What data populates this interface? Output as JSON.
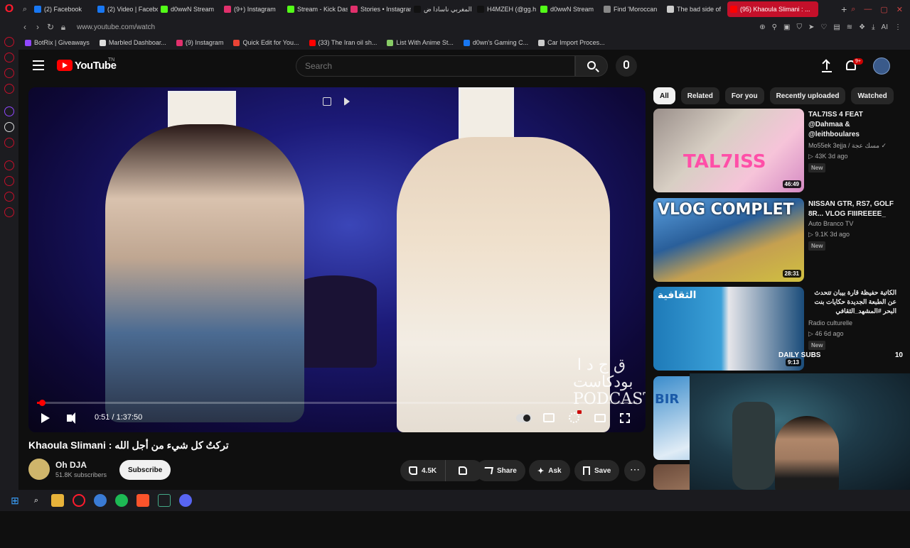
{
  "browser": {
    "tabs": [
      {
        "label": "(2) Facebook",
        "color": "#1877f2"
      },
      {
        "label": "(2) Video | Facebook",
        "color": "#1877f2"
      },
      {
        "label": "d0wwN Stream",
        "color": "#53fc18"
      },
      {
        "label": "(9+) Instagram",
        "color": "#e1306c"
      },
      {
        "label": "Stream - Kick Dash",
        "color": "#53fc18"
      },
      {
        "label": "Stories • Instagram",
        "color": "#e1306c"
      },
      {
        "label": "المغربي ناسادا ض",
        "color": "#111111"
      },
      {
        "label": "H4MZEH (@gg.h",
        "color": "#111111"
      },
      {
        "label": "d0wwN Stream",
        "color": "#53fc18"
      },
      {
        "label": "Find 'Moroccan",
        "color": "#888888"
      },
      {
        "label": "The bad side of",
        "color": "#cccccc"
      },
      {
        "label": "(95) Khaoula Slimani : ...",
        "color": "#ff0000",
        "active": true
      }
    ],
    "url": "www.youtube.com/watch",
    "bookmarks": [
      {
        "label": "BotRix | Giveaways",
        "color": "#9147ff"
      },
      {
        "label": "Marbled Dashboar...",
        "color": "#dddddd"
      },
      {
        "label": "(9) Instagram",
        "color": "#e1306c"
      },
      {
        "label": "Quick Edit for You...",
        "color": "#ea4335"
      },
      {
        "label": "(33) The Iran oil sh...",
        "color": "#ff0000"
      },
      {
        "label": "List With Anime St...",
        "color": "#88cc66"
      },
      {
        "label": "d0wn's Gaming C...",
        "color": "#1877f2"
      },
      {
        "label": "Car Import Proces...",
        "color": "#cccccc"
      }
    ]
  },
  "youtube": {
    "logo_text": "YouTube",
    "region": "TN",
    "search_placeholder": "Search",
    "notifications": "9+",
    "player": {
      "time": "0:51 / 1:37:50",
      "progress": 0.0087,
      "watermark": "ق ج د ا بودكاست PODCAST"
    },
    "video": {
      "title": "Khaoula Slimani : تركتُ كل شيء من أجل الله",
      "channel": "Oh DJA",
      "subscribers": "51.8K subscribers",
      "subscribe_label": "Subscribe",
      "likes": "4.5K",
      "share_label": "Share",
      "ask_label": "Ask",
      "save_label": "Save"
    },
    "chips": [
      "All",
      "Related",
      "For you",
      "Recently uploaded",
      "Watched"
    ],
    "recommendations": [
      {
        "title": "TAL7ISS 4 FEAT @Dahmaa & @leithboulares",
        "channel": "Mo55ek 3ejja / مسك عجة ✓",
        "meta": "▷ 43K  3d ago",
        "badge": "New",
        "duration": "46:49",
        "thumb_text": "TAL7ISS"
      },
      {
        "title": "NISSAN GTR, RS7, GOLF 8R... VLOG FIIIREEEE_",
        "channel": "Auto Branco TV",
        "meta": "▷ 9.1K  3d ago",
        "badge": "New",
        "duration": "28:31",
        "thumb_text": "VLOG COMPLET"
      },
      {
        "title": "الكاتبة حفيظة قارة بيبان تتحدث عن الطبعة الجديدة حكايات بنت البحر #المشهد_الثقافي",
        "channel": "Radio culturelle",
        "meta": "▷ 46  6d ago",
        "badge": "New",
        "duration": "9:13",
        "thumb_text": "الثقافية"
      },
      {
        "title": "",
        "channel": "",
        "meta": "",
        "badge": "",
        "duration": "",
        "thumb_text": "BIR"
      },
      {
        "title": "",
        "channel": "",
        "meta": "",
        "badge": "",
        "duration": "",
        "thumb_text": ""
      }
    ]
  },
  "overlay": {
    "daily_subs_label": "DAILY SUBS",
    "daily_subs_count": "10"
  }
}
